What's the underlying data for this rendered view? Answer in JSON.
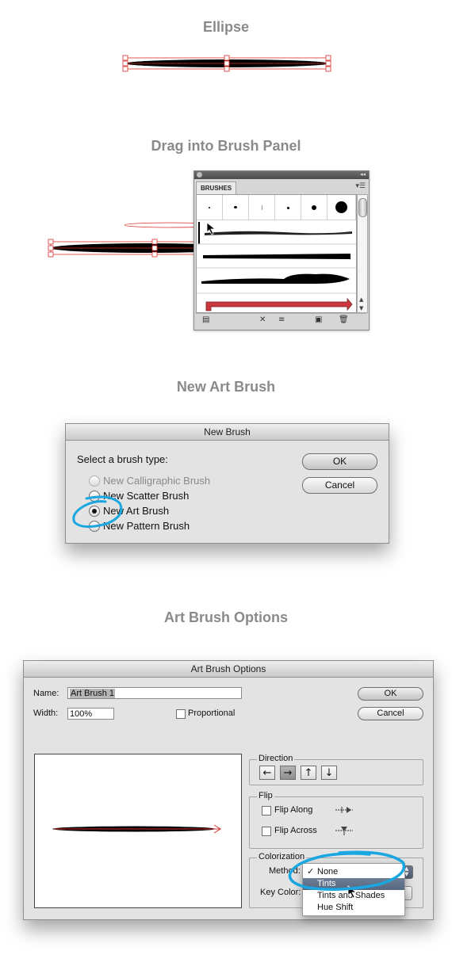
{
  "headings": {
    "ellipse": "Ellipse",
    "drag": "Drag into Brush Panel",
    "new_art_brush": "New Art Brush",
    "art_brush_options": "Art Brush Options"
  },
  "brushes_panel": {
    "tab": "BRUSHES",
    "menu_icon": "panel-menu-icon",
    "footer_icons": [
      "brush-libraries-icon",
      "remove-stroke-icon",
      "options-icon",
      "new-brush-icon",
      "delete-brush-icon"
    ]
  },
  "new_brush_dialog": {
    "title": "New Brush",
    "prompt": "Select a brush type:",
    "options": [
      {
        "label": "New Calligraphic Brush",
        "enabled": false,
        "selected": false
      },
      {
        "label": "New Scatter Brush",
        "enabled": true,
        "selected": false
      },
      {
        "label": "New Art Brush",
        "enabled": true,
        "selected": true
      },
      {
        "label": "New Pattern Brush",
        "enabled": true,
        "selected": false
      }
    ],
    "ok": "OK",
    "cancel": "Cancel"
  },
  "art_brush_options": {
    "title": "Art Brush Options",
    "name_label": "Name:",
    "name_value": "Art Brush 1",
    "width_label": "Width:",
    "width_value": "100%",
    "proportional_label": "Proportional",
    "ok": "OK",
    "cancel": "Cancel",
    "direction_label": "Direction",
    "direction_buttons": [
      "←",
      "→",
      "↑",
      "↓"
    ],
    "direction_selected": "→",
    "flip_label": "Flip",
    "flip_along": "Flip Along",
    "flip_across": "Flip Across",
    "colorization_label": "Colorization",
    "method_label": "Method:",
    "key_color_label": "Key Color:",
    "method_options": [
      "None",
      "Tints",
      "Tints and Shades",
      "Hue Shift"
    ],
    "method_checked": "None",
    "method_highlighted": "Tints"
  },
  "colors": {
    "highlight_circle": "#1aa6e0",
    "selection_red": "#d9302c",
    "heading_gray": "#8a8a8a"
  }
}
